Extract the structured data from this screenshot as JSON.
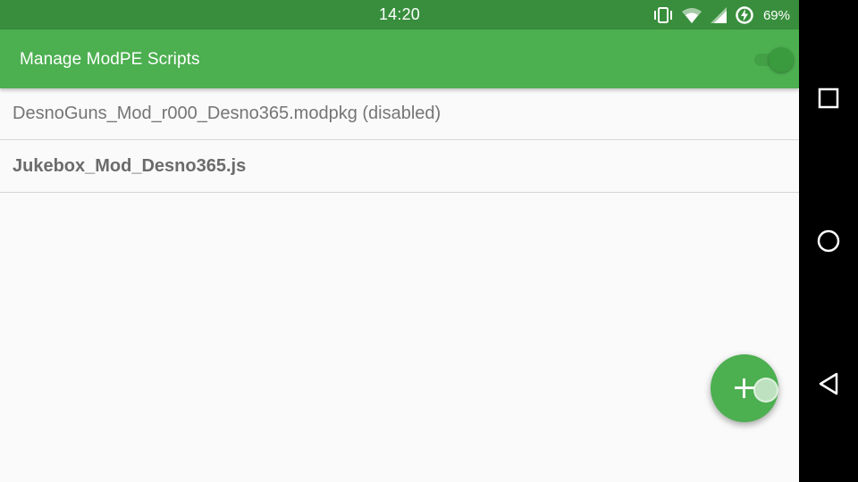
{
  "status_bar": {
    "time": "14:20",
    "battery_percent": "69%",
    "icons": [
      "vibrate-icon",
      "wifi-icon",
      "cell-signal-icon",
      "battery-charging-icon"
    ]
  },
  "app_bar": {
    "title": "Manage ModPE Scripts",
    "master_toggle_on": true
  },
  "scripts": [
    {
      "name": "DesnoGuns_Mod_r000_Desno365.modpkg (disabled)",
      "enabled": false
    },
    {
      "name": "Jukebox_Mod_Desno365.js",
      "enabled": true
    }
  ],
  "fab": {
    "icon": "plus-icon"
  },
  "nav_bar": {
    "buttons": [
      "recents-icon",
      "home-icon",
      "back-icon"
    ]
  },
  "colors": {
    "status_bar": "#388e3c",
    "app_bar": "#4caf50",
    "background": "#fafafa",
    "text_secondary": "#757575"
  }
}
